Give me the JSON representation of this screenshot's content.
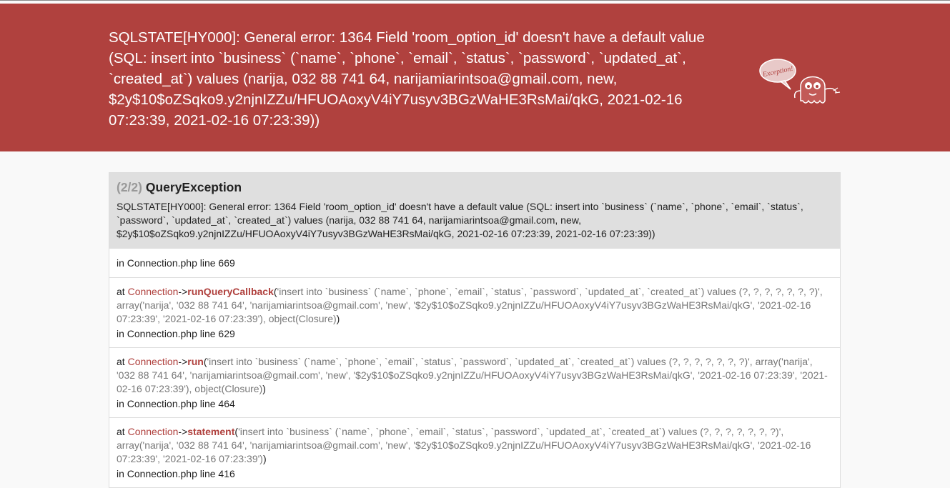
{
  "header": {
    "message": "SQLSTATE[HY000]: General error: 1364 Field 'room_option_id' doesn't have a default value (SQL: insert into `business` (`name`, `phone`, `email`, `status`, `password`, `updated_at`, `created_at`) values (narija, 032 88 741 64, narijamiarintsoa@gmail.com, new, $2y$10$oZSqko9.y2njnIZZu/HFUOAoxyV4iY7usyv3BGzWaHE3RsMai/qkG, 2021-02-16 07:23:39, 2021-02-16 07:23:39))",
    "ghost_label": "Exception!",
    "ghost_icon": "exception-ghost-icon"
  },
  "exception": {
    "count": "(2/2)",
    "class": "QueryException",
    "message": "SQLSTATE[HY000]: General error: 1364 Field 'room_option_id' doesn't have a default value (SQL: insert into `business` (`name`, `phone`, `email`, `status`, `password`, `updated_at`, `created_at`) values (narija, 032 88 741 64, narijamiarintsoa@gmail.com, new, $2y$10$oZSqko9.y2njnIZZu/HFUOAoxyV4iY7usyv3BGzWaHE3RsMai/qkG, 2021-02-16 07:23:39, 2021-02-16 07:23:39))"
  },
  "trace": [
    {
      "location": "in Connection.php line 669"
    },
    {
      "at": "at ",
      "class": "Connection",
      "arrow": "->",
      "function": "runQueryCallback",
      "open": "(",
      "args": "'insert into `business` (`name`, `phone`, `email`, `status`, `password`, `updated_at`, `created_at`) values (?, ?, ?, ?, ?, ?, ?)', array('narija', '032 88 741 64', 'narijamiarintsoa@gmail.com', 'new', '$2y$10$oZSqko9.y2njnIZZu/HFUOAoxyV4iY7usyv3BGzWaHE3RsMai/qkG', '2021-02-16 07:23:39', '2021-02-16 07:23:39'), object(Closure)",
      "close": ")",
      "location": "in Connection.php line 629"
    },
    {
      "at": "at ",
      "class": "Connection",
      "arrow": "->",
      "function": "run",
      "open": "(",
      "args": "'insert into `business` (`name`, `phone`, `email`, `status`, `password`, `updated_at`, `created_at`) values (?, ?, ?, ?, ?, ?, ?)', array('narija', '032 88 741 64', 'narijamiarintsoa@gmail.com', 'new', '$2y$10$oZSqko9.y2njnIZZu/HFUOAoxyV4iY7usyv3BGzWaHE3RsMai/qkG', '2021-02-16 07:23:39', '2021-02-16 07:23:39'), object(Closure)",
      "close": ")",
      "location": "in Connection.php line 464"
    },
    {
      "at": "at ",
      "class": "Connection",
      "arrow": "->",
      "function": "statement",
      "open": "(",
      "args": "'insert into `business` (`name`, `phone`, `email`, `status`, `password`, `updated_at`, `created_at`) values (?, ?, ?, ?, ?, ?, ?)', array('narija', '032 88 741 64', 'narijamiarintsoa@gmail.com', 'new', '$2y$10$oZSqko9.y2njnIZZu/HFUOAoxyV4iY7usyv3BGzWaHE3RsMai/qkG', '2021-02-16 07:23:39', '2021-02-16 07:23:39')",
      "close": ")",
      "location": "in Connection.php line 416"
    }
  ]
}
